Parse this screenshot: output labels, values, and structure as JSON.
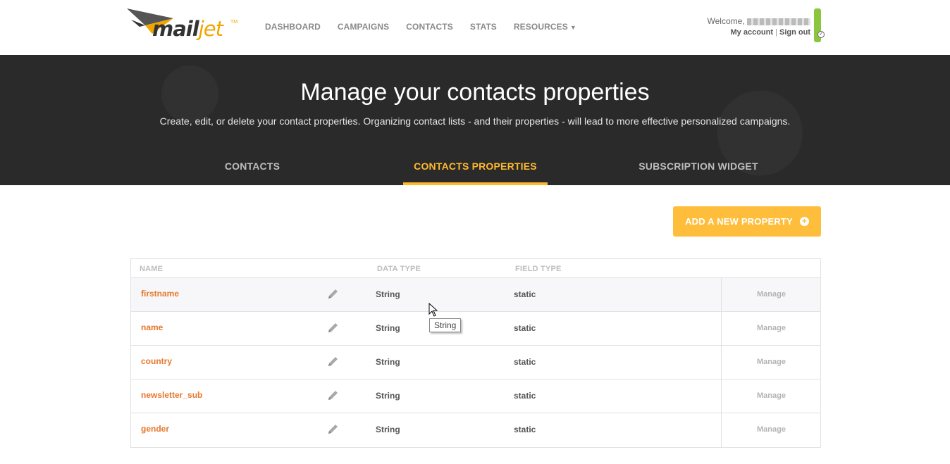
{
  "header": {
    "logo_main": "mail",
    "logo_accent": "jet",
    "logo_tm": "TM",
    "nav": [
      {
        "label": "DASHBOARD"
      },
      {
        "label": "CAMPAIGNS"
      },
      {
        "label": "CONTACTS"
      },
      {
        "label": "STATS"
      },
      {
        "label": "RESOURCES"
      }
    ],
    "welcome_label": "Welcome,",
    "my_account": "My account",
    "separator": "|",
    "sign_out": "Sign out",
    "status_color": "#8cc63f"
  },
  "hero": {
    "title": "Manage your contacts properties",
    "subtitle": "Create, edit, or delete your contact properties. Organizing contact lists - and their properties - will lead to more effective personalized campaigns.",
    "tabs": [
      {
        "label": "CONTACTS",
        "active": false
      },
      {
        "label": "CONTACTS PROPERTIES",
        "active": true
      },
      {
        "label": "SUBSCRIPTION WIDGET",
        "active": false
      }
    ]
  },
  "actions": {
    "add_property": "ADD A NEW PROPERTY"
  },
  "table": {
    "columns": {
      "name": "NAME",
      "data_type": "DATA TYPE",
      "field_type": "FIELD TYPE"
    },
    "rows": [
      {
        "name": "firstname",
        "data_type": "String",
        "field_type": "static",
        "action": "Manage"
      },
      {
        "name": "name",
        "data_type": "String",
        "field_type": "static",
        "action": "Manage"
      },
      {
        "name": "country",
        "data_type": "String",
        "field_type": "static",
        "action": "Manage"
      },
      {
        "name": "newsletter_sub",
        "data_type": "String",
        "field_type": "static",
        "action": "Manage"
      },
      {
        "name": "gender",
        "data_type": "String",
        "field_type": "static",
        "action": "Manage"
      }
    ]
  },
  "tooltip": {
    "text": "String"
  },
  "colors": {
    "accent": "#ffb92e",
    "link_orange": "#e8782d",
    "hero_bg": "#2a2a2a"
  }
}
